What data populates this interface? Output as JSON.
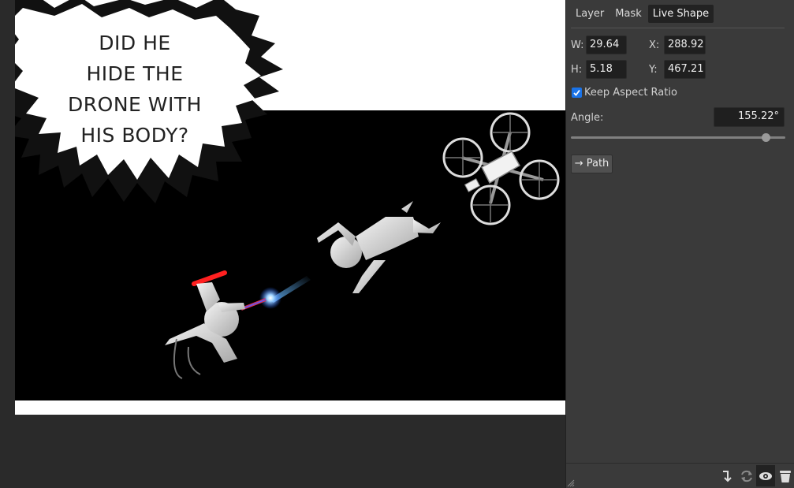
{
  "canvas": {
    "bubble_text": [
      "DID HE",
      "HIDE THE",
      "DRONE WITH",
      "HIS BODY?"
    ]
  },
  "panel": {
    "tabs": [
      {
        "label": "Layer",
        "active": false
      },
      {
        "label": "Mask",
        "active": false
      },
      {
        "label": "Live Shape",
        "active": true
      }
    ],
    "w_label": "W:",
    "w_value": "29.64",
    "x_label": "X:",
    "x_value": "288.92",
    "h_label": "H:",
    "h_value": "5.18",
    "y_label": "Y:",
    "y_value": "467.21",
    "keep_aspect_label": "Keep Aspect Ratio",
    "keep_aspect_checked": true,
    "angle_label": "Angle:",
    "angle_value": "155.22°",
    "angle_slider_fraction": 0.91,
    "path_button_label": "→ Path"
  },
  "bottom_icons": [
    "merge-down-icon",
    "refresh-icon",
    "visibility-eye-icon",
    "trash-icon"
  ],
  "colors": {
    "panel_bg": "#3a3a3a",
    "field_bg": "#1f1f1f",
    "checkbox_accent": "#1a73e8",
    "workspace_bg": "#2a2a2a",
    "saber_red": "#ff2020",
    "glow_blue": "#66b8ff"
  }
}
